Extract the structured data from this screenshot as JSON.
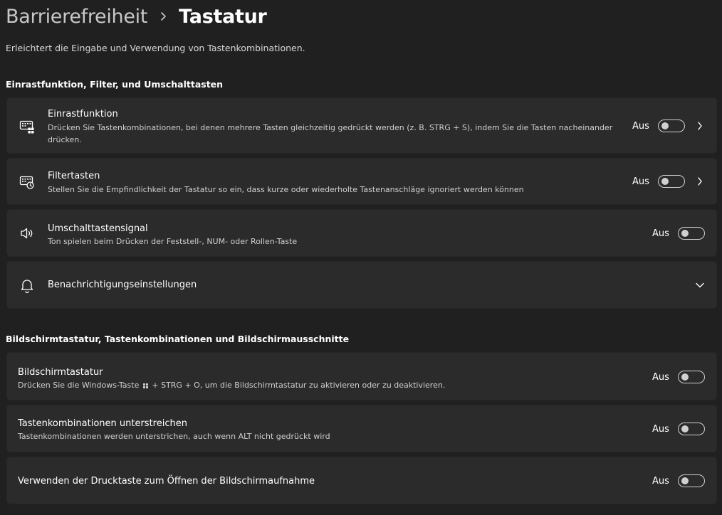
{
  "breadcrumb": {
    "parent": "Barrierefreiheit",
    "current": "Tastatur"
  },
  "subtitle": "Erleichtert die Eingabe und Verwendung von Tastenkombinationen.",
  "sections": {
    "filters": {
      "title": "Einrastfunktion, Filter, und Umschalttasten",
      "items": [
        {
          "title": "Einrastfunktion",
          "description": "Drücken Sie Tastenkombinationen, bei denen mehrere Tasten gleichzeitig gedrückt werden (z. B. STRG + S), indem Sie die Tasten nacheinander drücken.",
          "state": "Aus",
          "toggle_on": false,
          "icon": "keyboard-sticky-icon"
        },
        {
          "title": "Filtertasten",
          "description": "Stellen Sie die Empfindlichkeit der Tastatur so ein, dass kurze oder wiederholte Tastenanschläge ignoriert werden können",
          "state": "Aus",
          "toggle_on": false,
          "icon": "keyboard-filter-icon"
        },
        {
          "title": "Umschalttastensignal",
          "description": "Ton spielen beim Drücken der Feststell-, NUM- oder Rollen-Taste",
          "state": "Aus",
          "toggle_on": false,
          "icon": "speaker-icon"
        },
        {
          "title": "Benachrichtigungseinstellungen",
          "icon": "bell-icon"
        }
      ]
    },
    "onscreen": {
      "title": "Bildschirmtastatur, Tastenkombinationen und Bildschirmausschnitte",
      "items": [
        {
          "title": "Bildschirmtastatur",
          "description_before": "Drücken Sie die Windows-Taste",
          "description_after": "+ STRG + O, um die Bildschirmtastatur zu aktivieren oder zu deaktivieren.",
          "state": "Aus",
          "toggle_on": false
        },
        {
          "title": "Tastenkombinationen unterstreichen",
          "description": "Tastenkombinationen werden unterstrichen, auch wenn ALT nicht gedrückt wird",
          "state": "Aus",
          "toggle_on": false
        },
        {
          "title": "Verwenden der Drucktaste zum Öffnen der Bildschirmaufnahme",
          "state": "Aus",
          "toggle_on": false
        }
      ]
    }
  },
  "colors": {
    "background": "#202020",
    "card": "#2b2b2b",
    "toggle_off": "#d0d0d0"
  }
}
